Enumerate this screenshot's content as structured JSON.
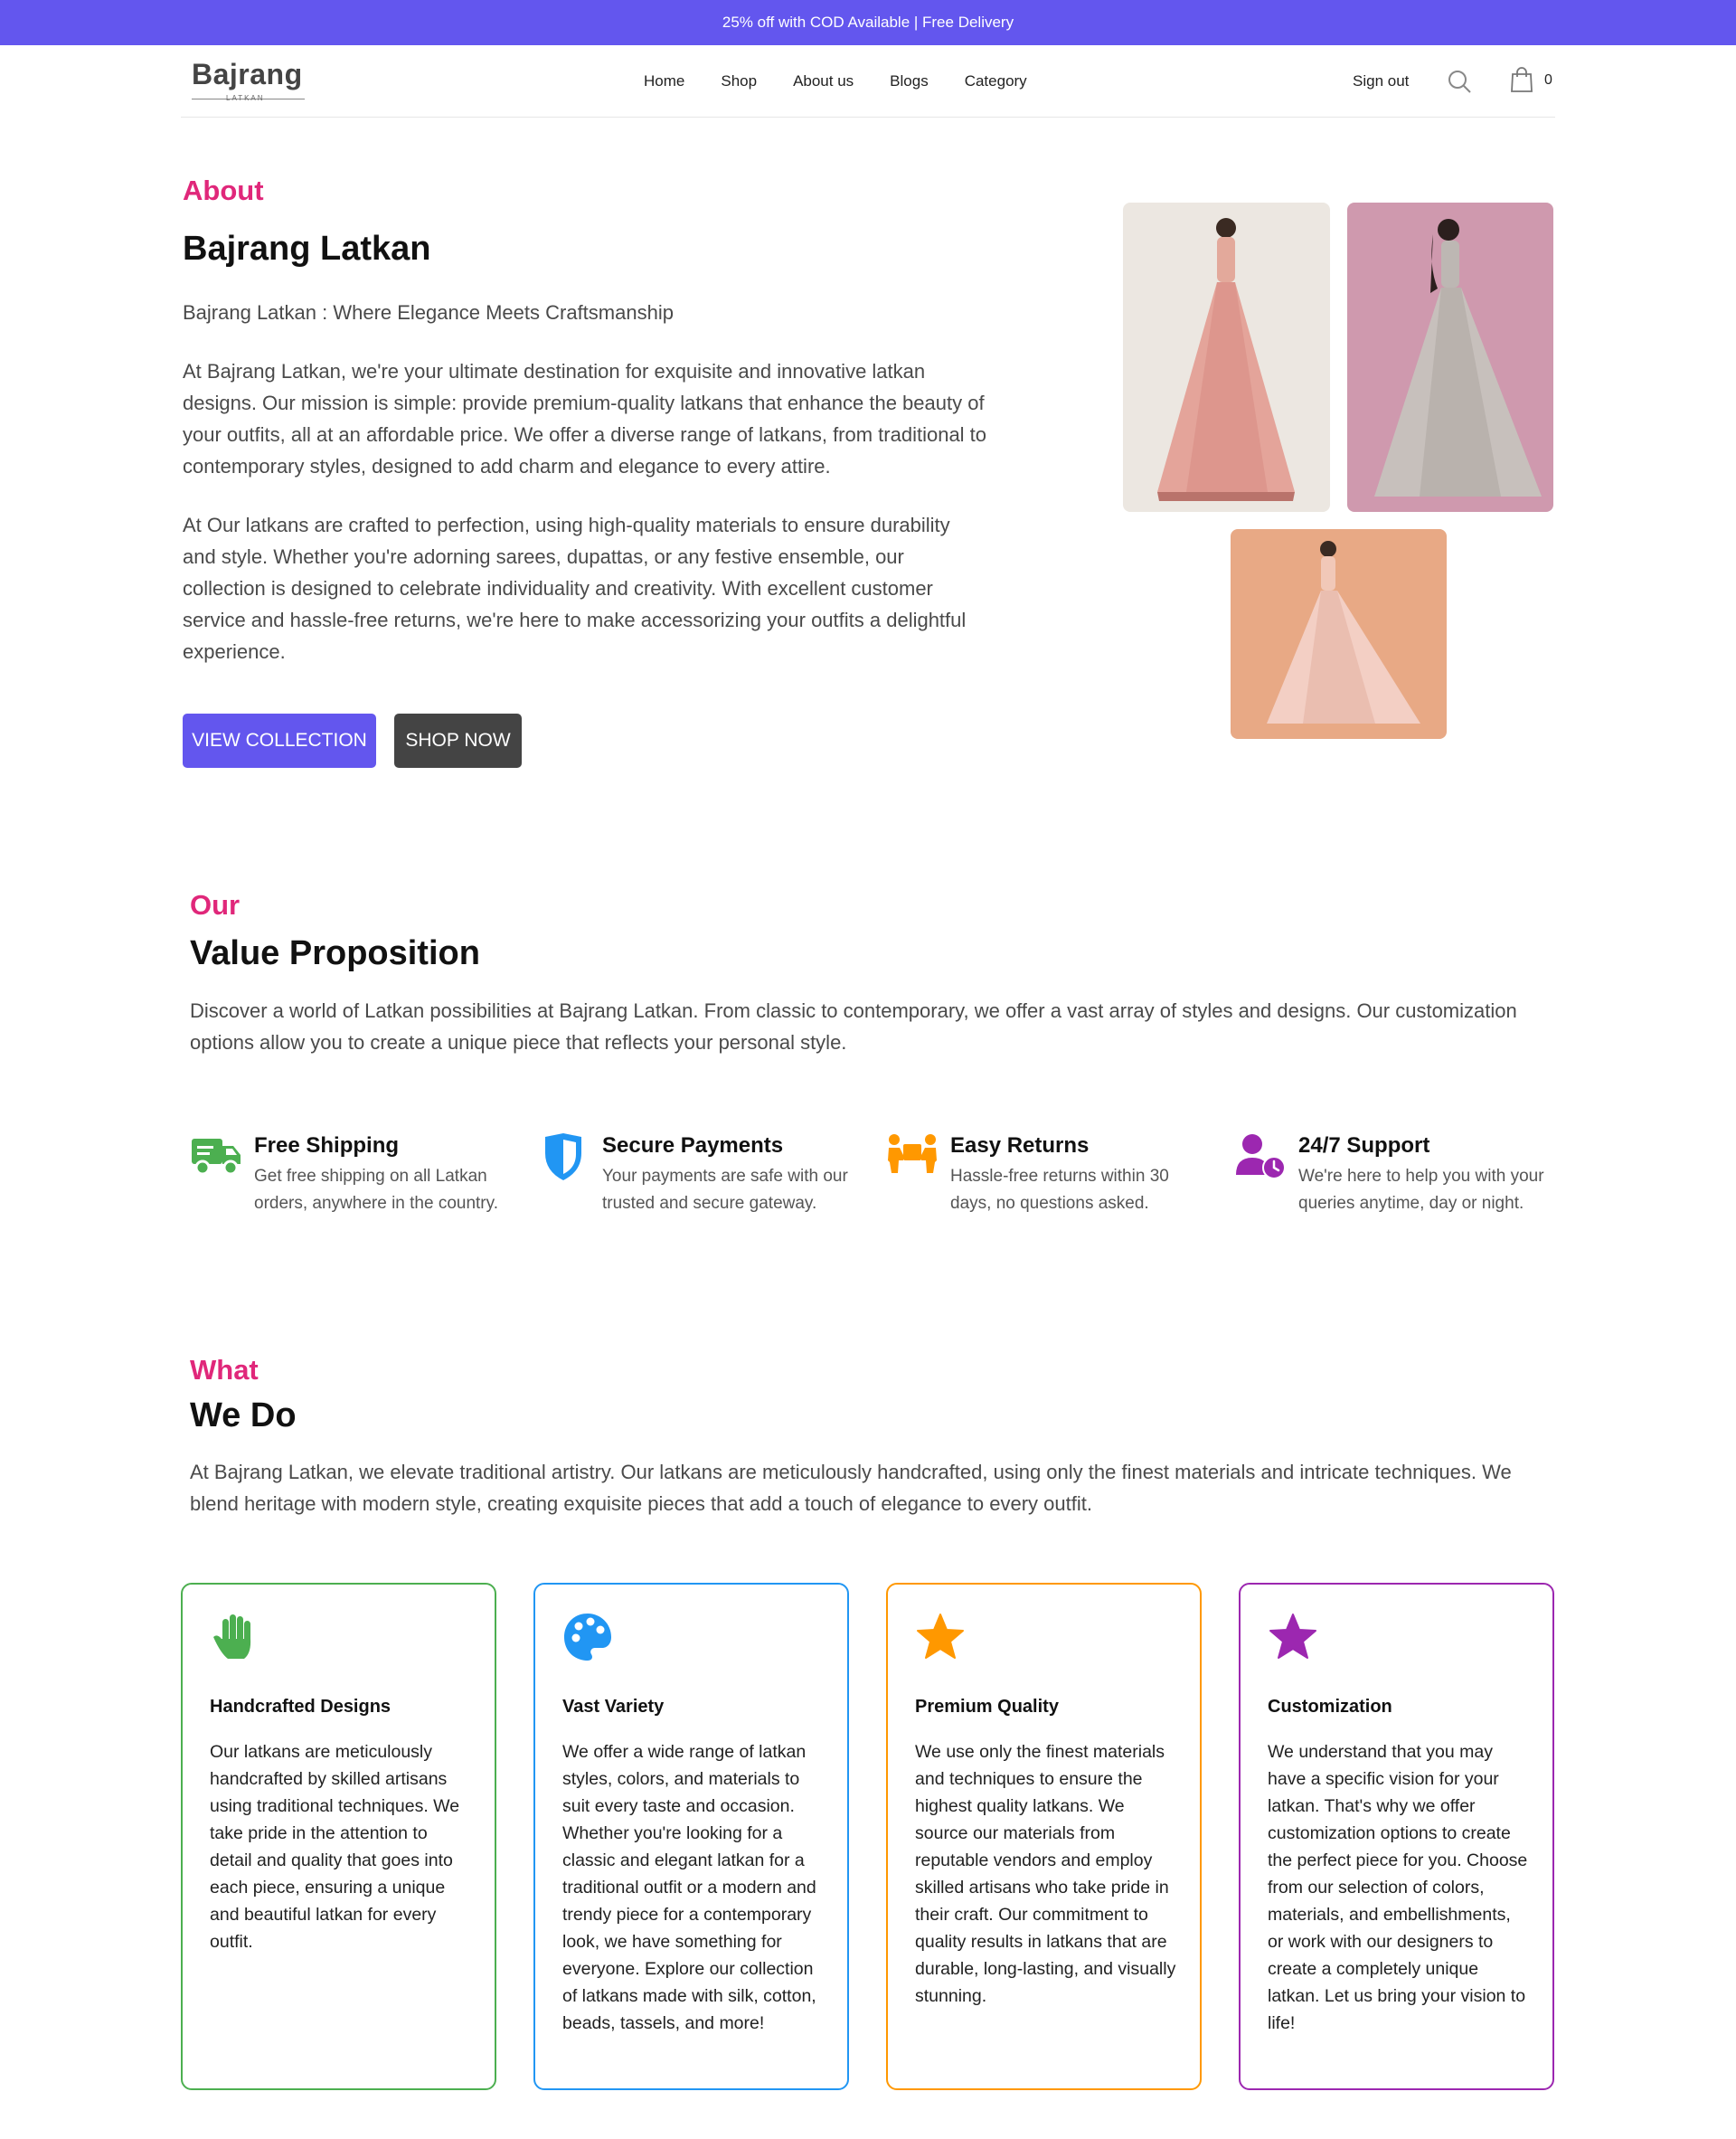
{
  "promo": {
    "text": "25% off with COD Available | Free Delivery"
  },
  "header": {
    "logo_word": "Bajrang",
    "logo_sub": "LATKAN",
    "nav": [
      "Home",
      "Shop",
      "About us",
      "Blogs",
      "Category"
    ],
    "sign_out": "Sign out",
    "cart_count": "0",
    "icons": {
      "search": "search-icon",
      "cart": "shopping-bag-icon"
    }
  },
  "about": {
    "eyebrow": "About",
    "title": "Bajrang Latkan",
    "tagline": "Bajrang Latkan : Where Elegance Meets Craftsmanship",
    "para1": "At Bajrang Latkan, we're your ultimate destination for exquisite and innovative latkan designs. Our mission is simple: provide premium-quality latkans that enhance the beauty of your outfits, all at an affordable price. We offer a diverse range of latkans, from traditional to contemporary styles, designed to add charm and elegance to every attire.",
    "para2": "At Our latkans are crafted to perfection, using high-quality materials to ensure durability and style. Whether you're adorning sarees, dupattas, or any festive ensemble, our collection is designed to celebrate individuality and creativity. With excellent customer service and hassle-free returns, we're here to make accessorizing your outfits a delightful experience.",
    "btn_view": "VIEW COLLECTION",
    "btn_shop": "SHOP NOW"
  },
  "value": {
    "eyebrow": "Our",
    "title": "Value Proposition",
    "desc": "Discover a world of Latkan possibilities at Bajrang Latkan. From classic to contemporary, we offer a vast array of styles and designs. Our customization options allow you to create a unique piece that reflects your personal style.",
    "features": [
      {
        "title": "Free Shipping",
        "text": "Get free shipping on all Latkan orders, anywhere in the country.",
        "icon": "truck-icon",
        "color": "#4CAF50"
      },
      {
        "title": "Secure Payments",
        "text": "Your payments are safe with our trusted and secure gateway.",
        "icon": "shield-icon",
        "color": "#2196F3"
      },
      {
        "title": "Easy Returns",
        "text": "Hassle-free returns within 30 days, no questions asked.",
        "icon": "people-carry-box-icon",
        "color": "#FF9800"
      },
      {
        "title": "24/7 Support",
        "text": "We're here to help you with your queries anytime, day or night.",
        "icon": "user-clock-icon",
        "color": "#9C27B0"
      }
    ]
  },
  "whatwedo": {
    "eyebrow": "What",
    "title": "We Do",
    "desc": "At Bajrang Latkan, we elevate traditional artistry. Our latkans are meticulously handcrafted, using only the finest materials and intricate techniques. We blend heritage with modern style, creating exquisite pieces that add a touch of elegance to every outfit.",
    "cards": [
      {
        "title": "Handcrafted Designs",
        "text": "Our latkans are meticulously handcrafted by skilled artisans using traditional techniques. We take pride in the attention to detail and quality that goes into each piece, ensuring a unique and beautiful latkan for every outfit.",
        "icon": "hand-icon",
        "color": "#4CAF50"
      },
      {
        "title": "Vast Variety",
        "text": "We offer a wide range of latkan styles, colors, and materials to suit every taste and occasion. Whether you're looking for a classic and elegant latkan for a traditional outfit or a modern and trendy piece for a contemporary look, we have something for everyone. Explore our collection of latkans made with silk, cotton, beads, tassels, and more!",
        "icon": "palette-icon",
        "color": "#2196F3"
      },
      {
        "title": "Premium Quality",
        "text": "We use only the finest materials and techniques to ensure the highest quality latkans. We source our materials from reputable vendors and employ skilled artisans who take pride in their craft. Our commitment to quality results in latkans that are durable, long-lasting, and visually stunning.",
        "icon": "star-icon",
        "color": "#FF9800"
      },
      {
        "title": "Customization",
        "text": "We understand that you may have a specific vision for your latkan. That's why we offer customization options to create the perfect piece for you. Choose from our selection of colors, materials, and embellishments, or work with our designers to create a completely unique latkan. Let us bring your vision to life!",
        "icon": "star-icon",
        "color": "#9C27B0"
      }
    ]
  }
}
